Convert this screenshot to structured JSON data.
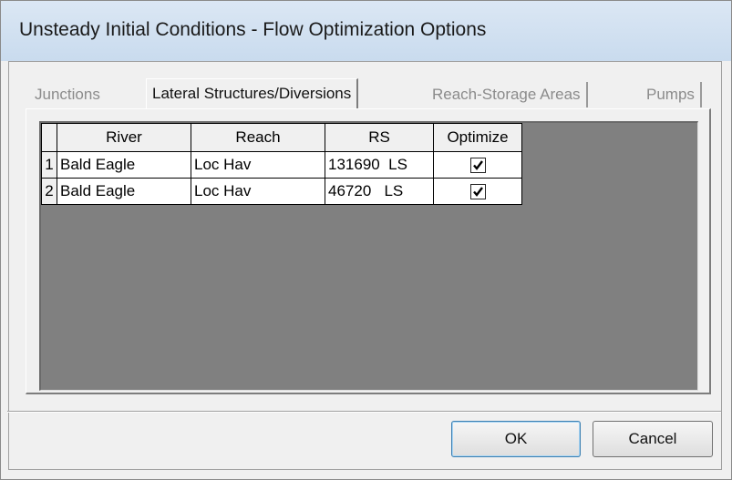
{
  "window": {
    "title": "Unsteady Initial Conditions - Flow Optimization Options"
  },
  "tabs": [
    {
      "label": "Junctions",
      "active": false
    },
    {
      "label": "Lateral Structures/Diversions",
      "active": true
    },
    {
      "label": "Reach-Storage Areas",
      "active": false
    },
    {
      "label": "Pumps",
      "active": false
    }
  ],
  "grid": {
    "headers": {
      "river": "River",
      "reach": "Reach",
      "rs": "RS",
      "optimize": "Optimize"
    },
    "rows": [
      {
        "num": "1",
        "river": "Bald Eagle",
        "reach": "Loc Hav",
        "rs": "131690  LS",
        "optimize": true
      },
      {
        "num": "2",
        "river": "Bald Eagle",
        "reach": "Loc Hav",
        "rs": "46720   LS",
        "optimize": true
      }
    ]
  },
  "buttons": {
    "ok": "OK",
    "cancel": "Cancel"
  }
}
